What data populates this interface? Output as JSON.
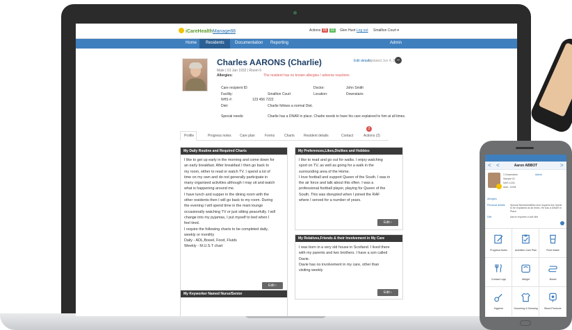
{
  "app": {
    "logo_brand": "iCareHealth",
    "logo_sub": "Manage88",
    "alerts_label": "Actions",
    "alerts_red": "05",
    "alerts_green": "02",
    "user_name": "Glen Hunt",
    "logout": "Log out",
    "site": "Smallton Court"
  },
  "nav": {
    "home": "Home",
    "residents": "Residents",
    "documentation": "Documentation",
    "reporting": "Reporting",
    "admin": "Admin"
  },
  "resident": {
    "name": "Charles AARONS (Charlie)",
    "edit_details": "Edit details",
    "updated": "Updated Jun 4, 2016",
    "dob": "Male | 01 Jan 1932 | Room 6",
    "allergies_label": "Allergies:",
    "allergies_text": "The resident has no known allergies / adverse reactions",
    "fields": [
      {
        "label": "Care recipient ID:",
        "value": ""
      },
      {
        "label": "Facility:",
        "value": "Smallton Court"
      },
      {
        "label": "NHS #:",
        "value": "123 456 7222"
      },
      {
        "label": "Diet:",
        "value": "Charlie follows a normal Diet."
      },
      {
        "label": "Special needs:",
        "value": "Charlie has a DNAR in place. Charlie needs to have his care explained to him at all times."
      }
    ],
    "doctor_label": "Doctor:",
    "doctor_value": "John Smith",
    "location_label": "Location:",
    "location_value": "Downstairs"
  },
  "tabs": [
    {
      "label": "Profile"
    },
    {
      "label": "Progress notes"
    },
    {
      "label": "Care plan"
    },
    {
      "label": "Forms"
    },
    {
      "label": "Charts"
    },
    {
      "label": "Resident details"
    },
    {
      "label": "Contact"
    },
    {
      "label": "Actions (2)"
    }
  ],
  "tab_badge": "2",
  "panels": {
    "routine": {
      "title": "My Daily Routine and Required Charts",
      "body": "I like to get up early in the morning and come down  for\nan early breakfast.  After breakfast I then go back to\nmy room, either to read or watch TV. I spend a lot of\ntime on my own and do not generally participate in\nmany organised activities although I may sit and watch\nwhat is happening around me.\nI have lunch and supper in the dining room with the\nother residents then I will go back to my room. During\nthe evening I will spend time in the main lounge\noccasionally watching TV or just sitting peacefully. I will\nchange into my pyjamas, I put myself to bed when I\nfeel tired.\nI require the following charts to be completed daily,\nweekly or monthly\nDaily -          ADL,Bowel, Food, Fluids\nWeekly -        M.U.S.T chart",
      "edit": "Edit"
    },
    "preferences": {
      "title": "My Preferences,Likes,Dislikes and Hobbies",
      "body": "I like to  read and go out for walks. I enjoy watching\nsport on TV, as well as  going for a walk in the\nsurrounding area of the Home.\nI love football and support Queen of the South. I was in\nthe air force and talk about this often. I was a\nprofessional football player, playing for Queen of the\nSouth. This was disrupted when I joined the RAF\nwhere I served for a number of years.",
      "edit": "Edit"
    },
    "relatives": {
      "title": "My Relatives,Friends & their Involvement in My Care",
      "body": "I was born in a very old house in Scotland. I lived there\nwith my parents and two brothers. I have a son called\nDavie.\nDavie has no involvement in my care, other than\nvisiting weekly",
      "edit": "Edit"
    },
    "keyworker": {
      "title": "My Keyworker Named Nurse/Senior"
    }
  },
  "phone": {
    "title": "Aaron ABBOT",
    "back": "<",
    "next": ">",
    "meta_1": "1  Downstairs",
    "meta_admin": "Admin",
    "meta_2": "Sample ID",
    "meta_3": "NHS 1234",
    "meta_4": "Adm. 12/08",
    "row_1_label": "Allergies",
    "row_2_label": "Personal details",
    "row_2_value": "Special Needs/Abilities and requires the needs to be explained at all times. He has a DNAR in Place",
    "row_3_label": "Diet",
    "row_3_value": "Aaron requires a soft diet",
    "tiles": [
      {
        "label": "Progress Notes"
      },
      {
        "label": "Activities Care Plan"
      },
      {
        "label": "Fluid Intake"
      },
      {
        "label": "Contact Logs"
      },
      {
        "label": "Weight"
      },
      {
        "label": "Bowel"
      },
      {
        "label": "Hygiene"
      },
      {
        "label": "Grooming & Dressing"
      },
      {
        "label": "Blood Pressure"
      }
    ]
  },
  "colors": {
    "nav_blue": "#3f7fbe",
    "alert_red": "#d9534f",
    "alert_green": "#5cb85c",
    "panel_head": "#3a3a3a",
    "title_navy": "#1d3f66"
  }
}
